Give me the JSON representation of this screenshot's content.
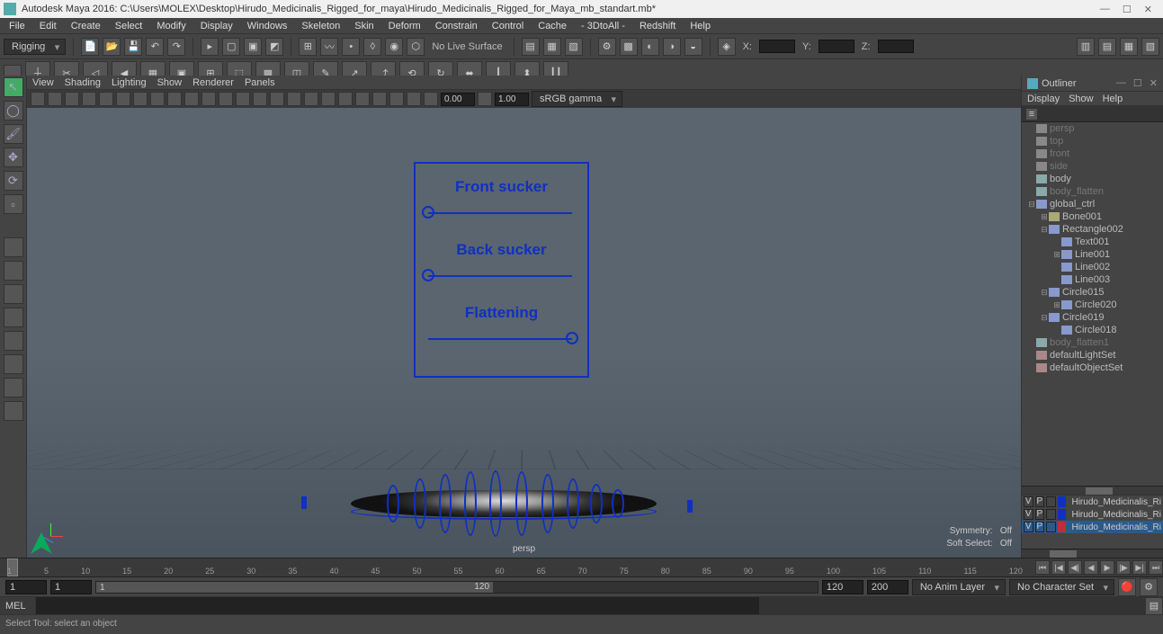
{
  "titlebar": {
    "app": "Autodesk Maya 2016:",
    "path": "C:\\Users\\MOLEX\\Desktop\\Hirudo_Medicinalis_Rigged_for_maya\\Hirudo_Medicinalis_Rigged_for_Maya_mb_standart.mb*"
  },
  "menubar": [
    "File",
    "Edit",
    "Create",
    "Select",
    "Modify",
    "Display",
    "Windows",
    "Skeleton",
    "Skin",
    "Deform",
    "Constrain",
    "Control",
    "Cache",
    "- 3DtoAll -",
    "Redshift",
    "Help"
  ],
  "mode_selector": "Rigging",
  "status_text": "No Live Surface",
  "xyz": {
    "xLabel": "X:",
    "yLabel": "Y:",
    "zLabel": "Z:"
  },
  "vp_menubar": [
    "View",
    "Shading",
    "Lighting",
    "Show",
    "Renderer",
    "Panels"
  ],
  "vp_toolbar": {
    "val1": "0.00",
    "val2": "1.00",
    "colorspace": "sRGB gamma"
  },
  "outliner": {
    "title": "Outliner",
    "menu": [
      "Display",
      "Show",
      "Help"
    ],
    "tree": [
      {
        "pad": 0,
        "exp": "",
        "ic": "ic-cam",
        "label": "persp",
        "dim": true
      },
      {
        "pad": 0,
        "exp": "",
        "ic": "ic-cam",
        "label": "top",
        "dim": true
      },
      {
        "pad": 0,
        "exp": "",
        "ic": "ic-cam",
        "label": "front",
        "dim": true
      },
      {
        "pad": 0,
        "exp": "",
        "ic": "ic-cam",
        "label": "side",
        "dim": true
      },
      {
        "pad": 0,
        "exp": "",
        "ic": "ic-mesh",
        "label": "body",
        "dim": false
      },
      {
        "pad": 0,
        "exp": "",
        "ic": "ic-mesh",
        "label": "body_flatten",
        "dim": true
      },
      {
        "pad": 0,
        "exp": "⊟",
        "ic": "ic-ctrl",
        "label": "global_ctrl",
        "dim": false
      },
      {
        "pad": 1,
        "exp": "⊞",
        "ic": "ic-joint",
        "label": "Bone001",
        "dim": false
      },
      {
        "pad": 1,
        "exp": "⊟",
        "ic": "ic-ctrl",
        "label": "Rectangle002",
        "dim": false
      },
      {
        "pad": 2,
        "exp": "",
        "ic": "ic-ctrl",
        "label": "Text001",
        "dim": false
      },
      {
        "pad": 2,
        "exp": "⊞",
        "ic": "ic-ctrl",
        "label": "Line001",
        "dim": false
      },
      {
        "pad": 2,
        "exp": "",
        "ic": "ic-ctrl",
        "label": "Line002",
        "dim": false
      },
      {
        "pad": 2,
        "exp": "",
        "ic": "ic-ctrl",
        "label": "Line003",
        "dim": false
      },
      {
        "pad": 1,
        "exp": "⊟",
        "ic": "ic-ctrl",
        "label": "Circle015",
        "dim": false
      },
      {
        "pad": 2,
        "exp": "⊞",
        "ic": "ic-ctrl",
        "label": "Circle020",
        "dim": false
      },
      {
        "pad": 1,
        "exp": "⊟",
        "ic": "ic-ctrl",
        "label": "Circle019",
        "dim": false
      },
      {
        "pad": 2,
        "exp": "",
        "ic": "ic-ctrl",
        "label": "Circle018",
        "dim": false
      },
      {
        "pad": 0,
        "exp": "",
        "ic": "ic-mesh",
        "label": "body_flatten1",
        "dim": true
      },
      {
        "pad": 0,
        "exp": "",
        "ic": "ic-set",
        "label": "defaultLightSet",
        "dim": false
      },
      {
        "pad": 0,
        "exp": "",
        "ic": "ic-set",
        "label": "defaultObjectSet",
        "dim": false
      }
    ]
  },
  "layers": [
    {
      "sel": false,
      "v": "V",
      "p": "P",
      "color": "#1030c0",
      "name": "Hirudo_Medicinalis_Ri"
    },
    {
      "sel": false,
      "v": "V",
      "p": "P",
      "color": "#1030c0",
      "name": "Hirudo_Medicinalis_Ri"
    },
    {
      "sel": true,
      "v": "V",
      "p": "P",
      "color": "#c03030",
      "name": "Hirudo_Medicinalis_Ri"
    }
  ],
  "rig_ui": {
    "slider1": {
      "label": "Front sucker",
      "pct": 0
    },
    "slider2": {
      "label": "Back sucker",
      "pct": 0
    },
    "slider3": {
      "label": "Flattening",
      "pct": 100
    }
  },
  "viewport_status": {
    "symmetry_l": "Symmetry:",
    "symmetry_v": "Off",
    "softsel_l": "Soft Select:",
    "softsel_v": "Off",
    "camera": "persp"
  },
  "time": {
    "ticks": [
      "1",
      "5",
      "10",
      "15",
      "20",
      "25",
      "30",
      "35",
      "40",
      "45",
      "50",
      "55",
      "60",
      "65",
      "70",
      "75",
      "80",
      "85",
      "90",
      "95",
      "100",
      "105",
      "110",
      "115",
      "120"
    ],
    "range_start_outer": "1",
    "range_start_inner": "1",
    "range_bar_label": "1",
    "range_end_inner": "120",
    "range_end_outer": "120",
    "range_alt": "200",
    "anim_layer": "No Anim Layer",
    "char_set": "No Character Set"
  },
  "mel": {
    "label": "MEL",
    "value": ""
  },
  "help_line": "Select Tool: select an object"
}
